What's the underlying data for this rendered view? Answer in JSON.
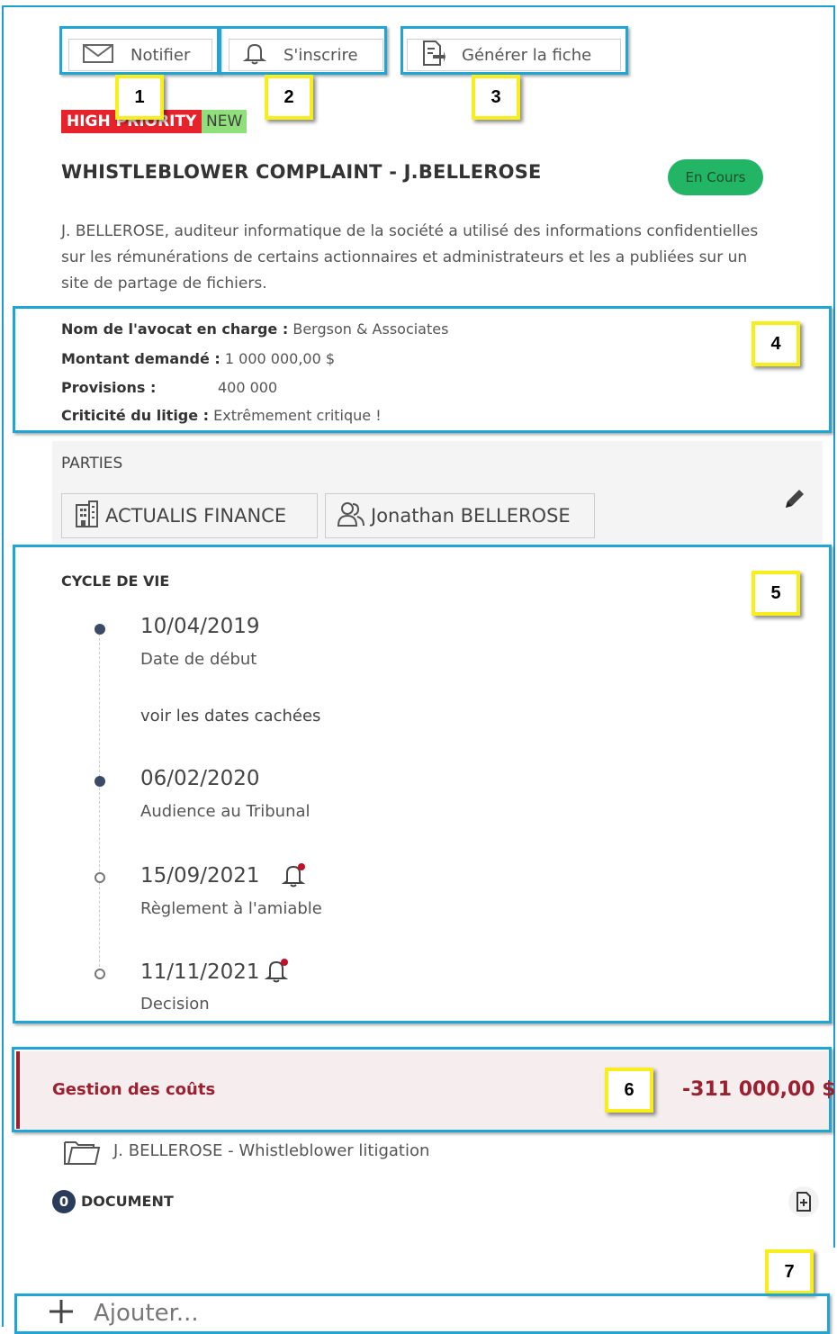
{
  "toolbar": {
    "notify_label": "Notifier",
    "subscribe_label": "S'inscrire",
    "generate_label": "Générer la fiche"
  },
  "badges": {
    "priority": "HIGH PRIORITY",
    "new": "NEW"
  },
  "case": {
    "title": "WHISTLEBLOWER COMPLAINT - J.BELLEROSE",
    "status": "En Cours",
    "description": "J. BELLEROSE, auditeur informatique de la société a utilisé des informations confidentielles sur les rémunérations de certains actionnaires et administrateurs et les a publiées sur un site de partage de fichiers."
  },
  "info": [
    {
      "label": "Nom de l'avocat en charge :",
      "value": "Bergson & Associates"
    },
    {
      "label": "Montant demandé :",
      "value": "1 000 000,00 $"
    },
    {
      "label": "Provisions :",
      "value": "400 000"
    },
    {
      "label": "Criticité du litige :",
      "value": "Extrêmement critique !"
    }
  ],
  "parties": {
    "title": "PARTIES",
    "items": [
      {
        "label": "ACTUALIS FINANCE",
        "icon": "building-icon"
      },
      {
        "label": "Jonathan BELLEROSE",
        "icon": "people-icon"
      }
    ]
  },
  "lifecycle": {
    "title": "CYCLE DE VIE",
    "events": [
      {
        "date": "10/04/2019",
        "label": "Date de début",
        "filled": true,
        "bell": false
      },
      {
        "date": "06/02/2020",
        "label": "Audience au Tribunal",
        "filled": true,
        "bell": false
      },
      {
        "date": "15/09/2021",
        "label": "Règlement à l'amiable",
        "filled": false,
        "bell": true
      },
      {
        "date": "11/11/2021",
        "label": "Decision",
        "filled": false,
        "bell": true
      }
    ],
    "hidden_link": "voir les dates cachées"
  },
  "costs": {
    "label": "Gestion des coûts",
    "value": "-311 000,00 $"
  },
  "folder": {
    "label": "J. BELLEROSE - Whistleblower litigation"
  },
  "documents": {
    "count": "0",
    "label": "DOCUMENT"
  },
  "add": {
    "label": "Ajouter..."
  },
  "callouts": [
    "1",
    "2",
    "3",
    "4",
    "5",
    "6",
    "7"
  ],
  "colors": {
    "highlight": "#1fa6d4",
    "callout_border": "#f7ee1c",
    "status_green": "#23b566",
    "priority_red": "#e8222a",
    "cost_red": "#9b2030"
  }
}
